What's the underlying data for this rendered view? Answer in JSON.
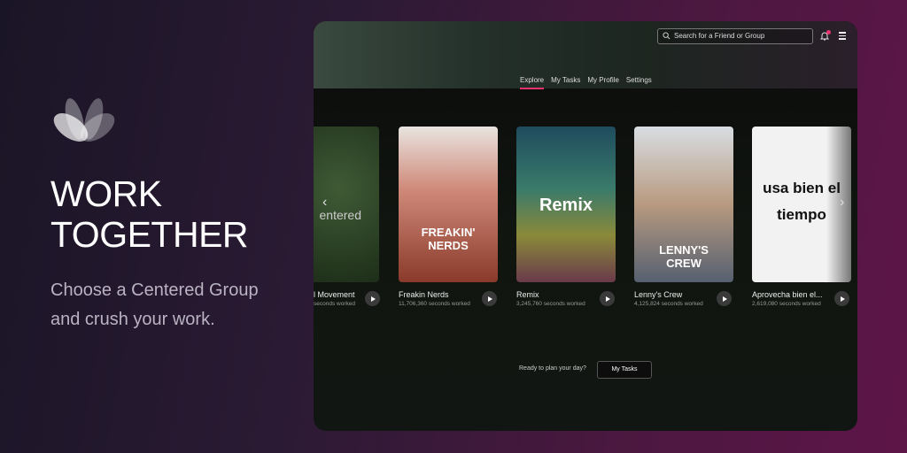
{
  "hero": {
    "title_line1": "WORK",
    "title_line2": "TOGETHER",
    "subtitle_line1": "Choose a Centered Group",
    "subtitle_line2": "and crush your work."
  },
  "header": {
    "search_placeholder": "Search for a Friend or Group",
    "tabs": [
      {
        "label": "Explore",
        "active": true
      },
      {
        "label": "My Tasks"
      },
      {
        "label": "My Profile"
      },
      {
        "label": "Settings"
      }
    ]
  },
  "cards": [
    {
      "title": "l Movement",
      "subtitle": "seconds worked",
      "art_text": "entered"
    },
    {
      "title": "Freakin Nerds",
      "subtitle": "11,706,360 seconds worked",
      "art_text": "FREAKIN' NERDS"
    },
    {
      "title": "Remix",
      "subtitle": "3,245,760 seconds worked",
      "art_text": "Remix"
    },
    {
      "title": "Lenny's Crew",
      "subtitle": "4,125,824 seconds worked",
      "art_text": "LENNY'S CREW"
    },
    {
      "title": "Aprovecha bien el...",
      "subtitle": "2,619,080 seconds worked",
      "art_text": "usa bien el tiempo"
    }
  ],
  "footer": {
    "prompt": "Ready to plan your day?",
    "button": "My Tasks"
  },
  "colors": {
    "accent": "#e8336f"
  }
}
